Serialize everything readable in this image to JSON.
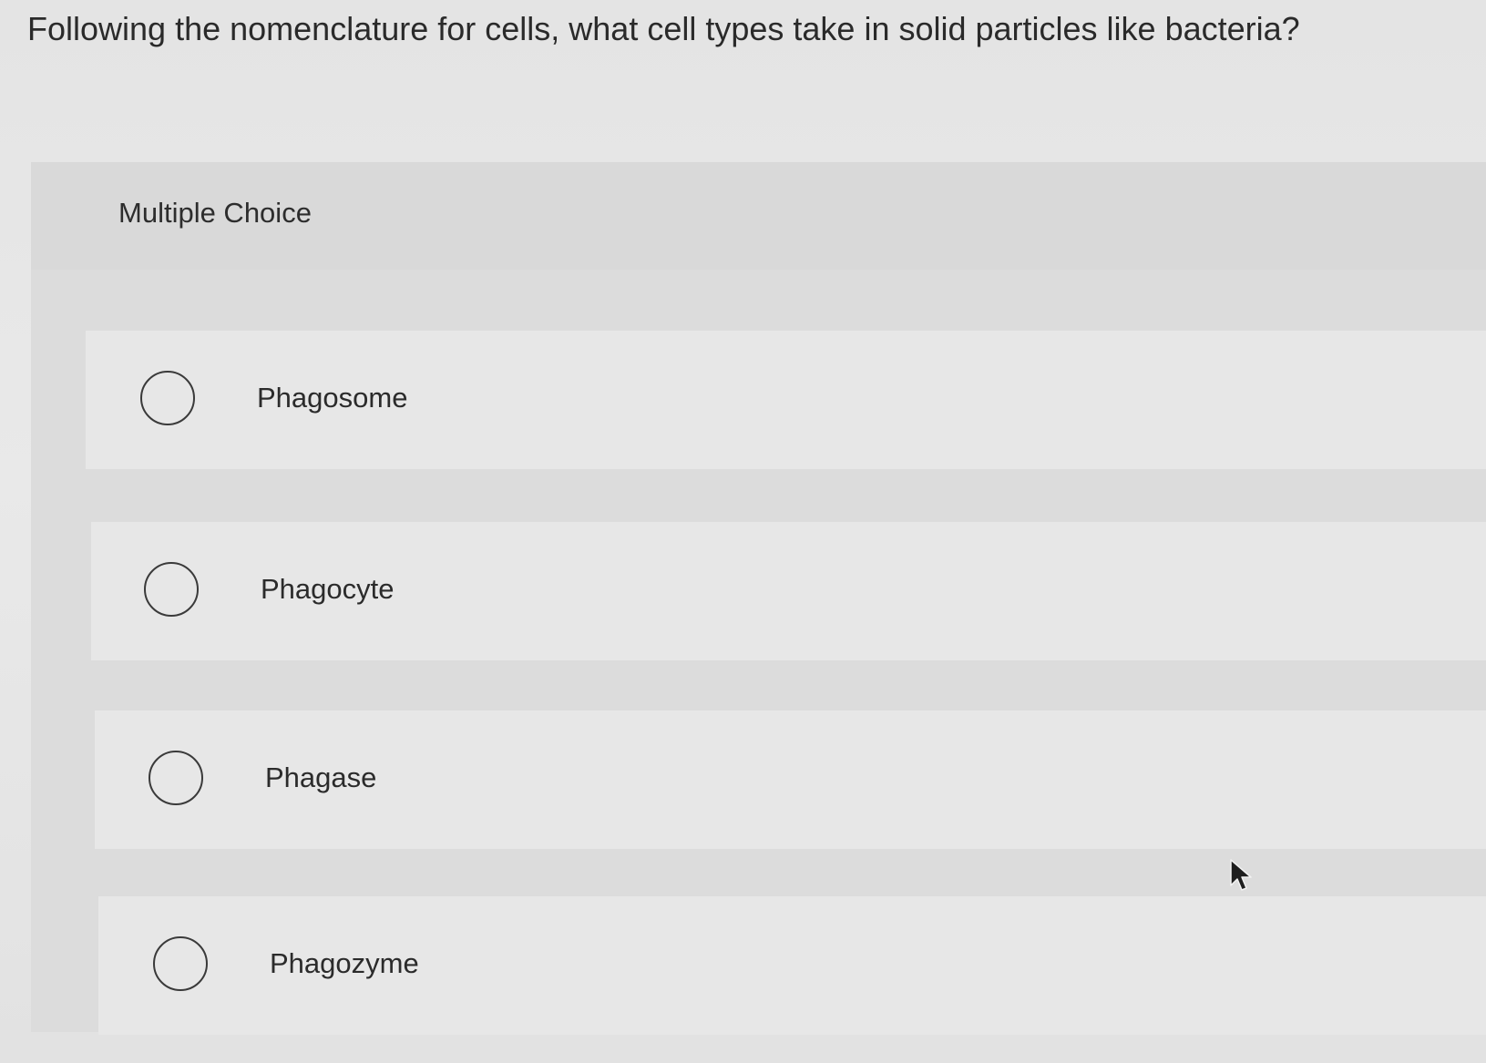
{
  "question": {
    "text": "Following the nomenclature for cells, what cell types take in solid particles like bacteria?"
  },
  "multiple_choice": {
    "header": "Multiple Choice",
    "options": [
      {
        "label": "Phagosome",
        "selected": false
      },
      {
        "label": "Phagocyte",
        "selected": false
      },
      {
        "label": "Phagase",
        "selected": false
      },
      {
        "label": "Phagozyme",
        "selected": false
      }
    ]
  },
  "icons": {
    "radio": "radio-button-icon",
    "cursor": "mouse-pointer-icon"
  },
  "colors": {
    "background": "#e4e4e4",
    "panel": "#dcdcdc",
    "option_row": "#e7e7e7",
    "text": "#2b2b2b",
    "radio_border": "#3a3a3a"
  }
}
